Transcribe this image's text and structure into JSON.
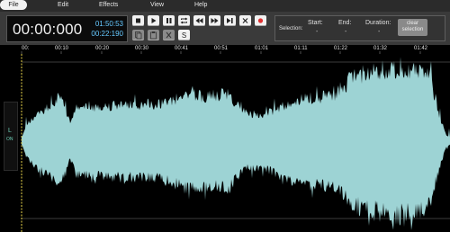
{
  "menu": {
    "file": "File",
    "edit": "Edit",
    "effects": "Effects",
    "view": "View",
    "help": "Help"
  },
  "time": {
    "current": "00:00:000",
    "selection_total": "01:50:53",
    "position": "00:22:190"
  },
  "selection": {
    "label": "Selection:",
    "start_label": "Start:",
    "end_label": "End:",
    "duration_label": "Duration:",
    "start_value": "-",
    "end_value": "-",
    "duration_value": "-",
    "clear_label_1": "clear",
    "clear_label_2": "selection"
  },
  "timeline": {
    "ticks": [
      "00:",
      "00:10",
      "00:20",
      "00:30",
      "00:41",
      "00:51",
      "01:01",
      "01:11",
      "01:22",
      "01:32",
      "01:42"
    ]
  },
  "channel": {
    "name": "L",
    "state": "ON"
  },
  "colors": {
    "waveform": "#9dd3d4",
    "record": "#e03030",
    "cursor": "#e8d44a"
  }
}
